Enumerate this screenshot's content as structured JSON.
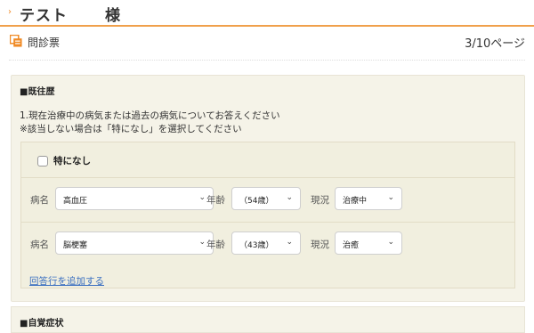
{
  "header": {
    "chevron": "›",
    "patient_name": "テスト",
    "honorific": "様"
  },
  "subbar": {
    "title": "問診票",
    "page": "3/10ページ",
    "icon": "questionnaire-icon"
  },
  "section_history": {
    "heading": "■既往歴",
    "question_line1": "1.現在治療中の病気または過去の病気についてお答えください",
    "question_line2": "※該当しない場合は「特になし」を選択してください",
    "none_label": "特になし",
    "none_checked": false,
    "rows": [
      {
        "disease_label": "病名",
        "disease": "高血圧",
        "age_label": "年齢",
        "age": "（54歳）",
        "status_label": "現況",
        "status": "治療中"
      },
      {
        "disease_label": "病名",
        "disease": "脳梗塞",
        "age_label": "年齢",
        "age": "（43歳）",
        "status_label": "現況",
        "status": "治癒"
      }
    ],
    "add_row_link": "回答行を追加する"
  },
  "section_symptoms": {
    "heading": "■自覚症状"
  },
  "colors": {
    "accent": "#f0a04b",
    "link": "#3a6fc0",
    "panel": "#f5f3e8"
  }
}
